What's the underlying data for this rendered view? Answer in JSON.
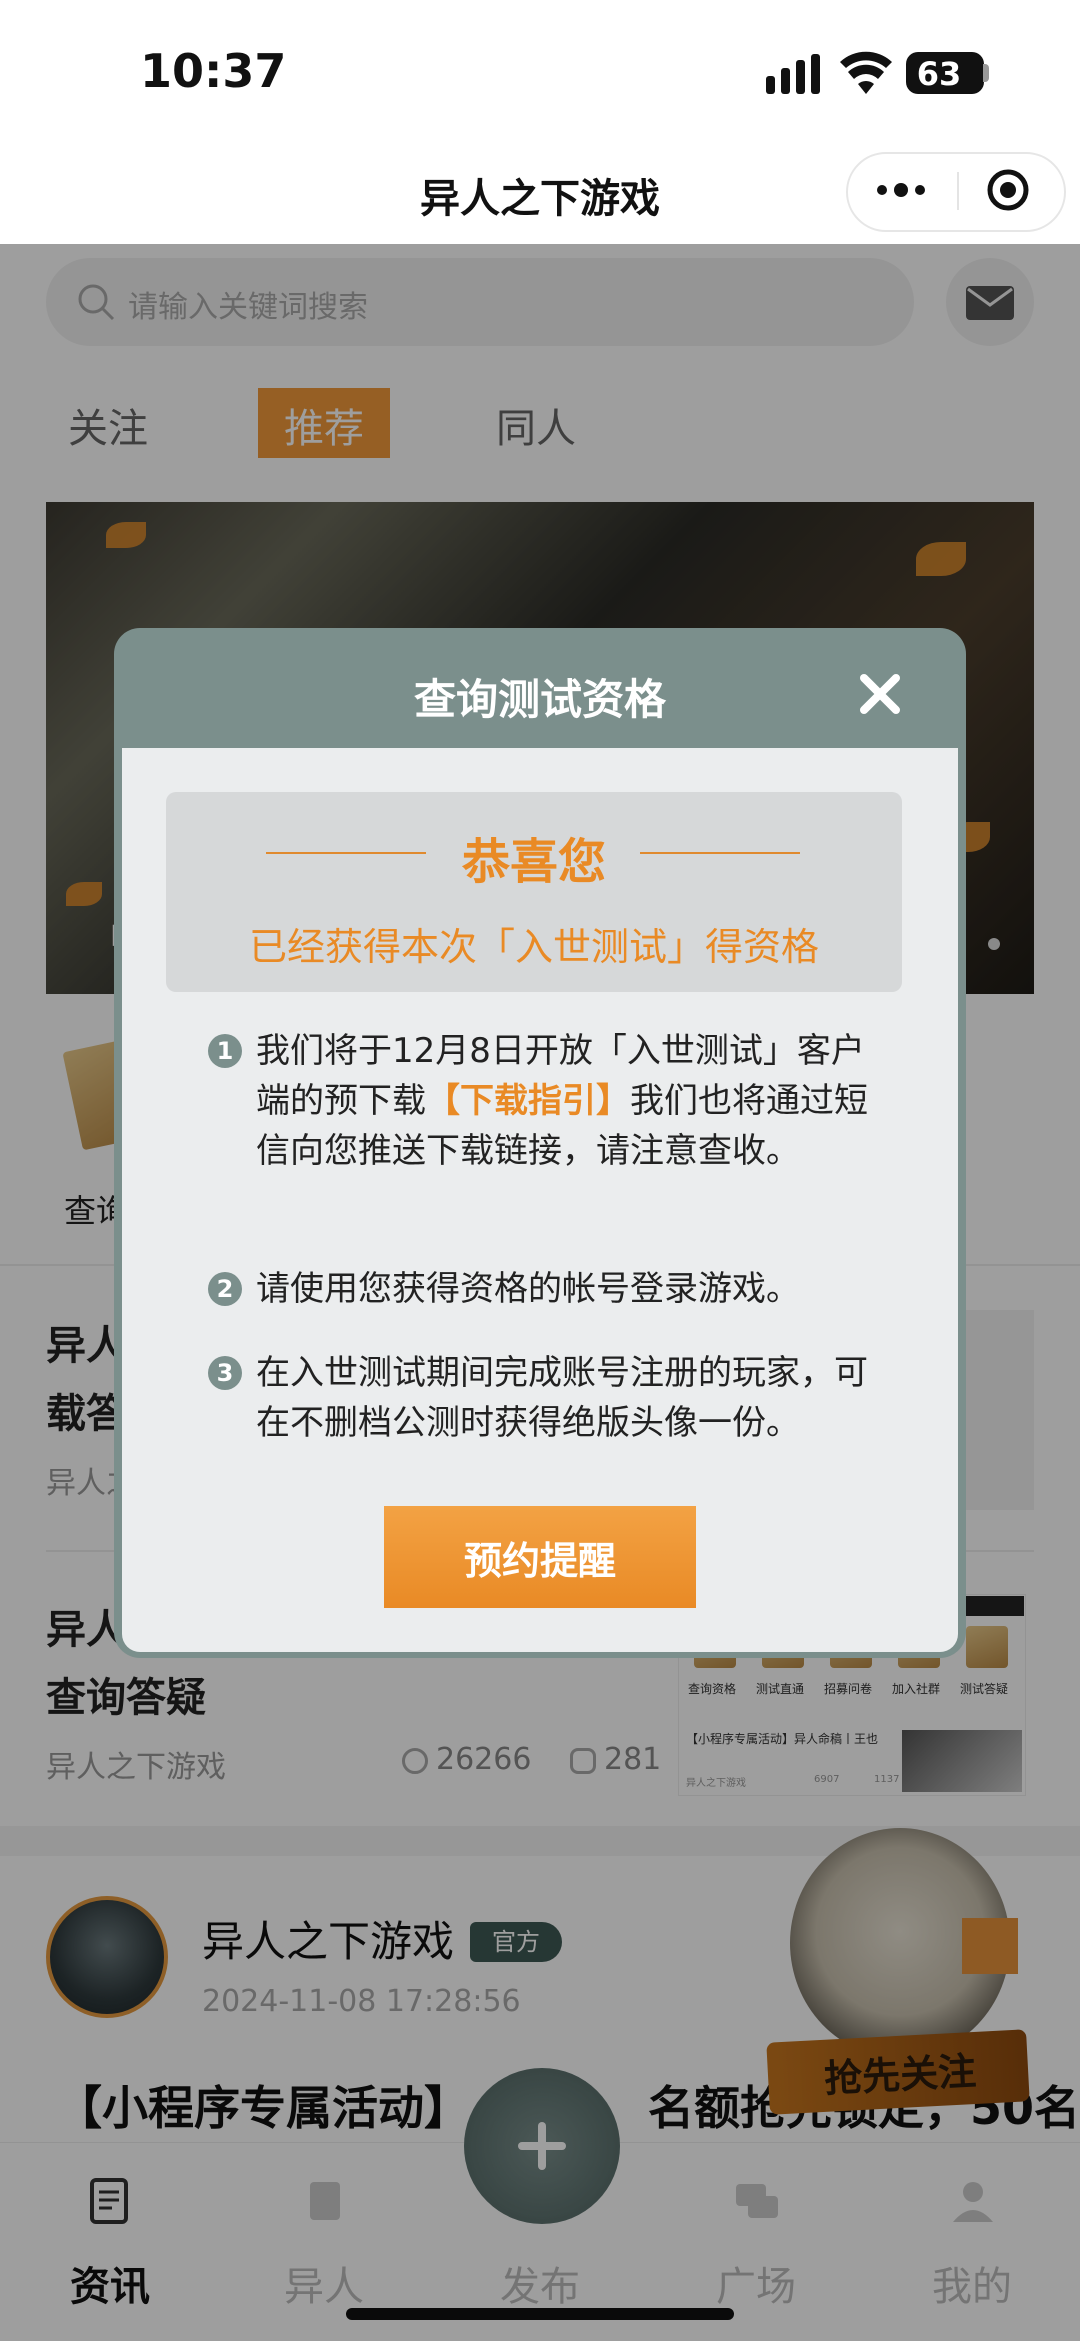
{
  "status_bar": {
    "time": "10:37",
    "battery": "63"
  },
  "nav": {
    "title": "异人之下游戏"
  },
  "search": {
    "placeholder": "请输入关键词搜索"
  },
  "tabs": [
    {
      "label": "关注"
    },
    {
      "label": "推荐"
    },
    {
      "label": "同人"
    }
  ],
  "banner": {
    "caption_fragment": "「"
  },
  "shortcut": {
    "label_fragment": "查询"
  },
  "articles": [
    {
      "title_line1": "异人",
      "title_line2": "载答",
      "source_fragment": "异人之"
    },
    {
      "title_line1": "异人",
      "title_line2": "查询答疑",
      "source": "异人之下游戏",
      "views": "26266",
      "comments": "281"
    }
  ],
  "thumb2": {
    "labels": [
      "查询资格",
      "测试直通",
      "招募问卷",
      "加入社群",
      "测试答疑"
    ],
    "post_title": "【小程序专属活动】异人命稿丨王也",
    "post_source": "异人之下游戏",
    "post_views": "6907",
    "post_comments": "1137"
  },
  "post": {
    "author": "异人之下游戏",
    "badge": "官方",
    "time": "2024-11-08 17:28:56",
    "title_left": "【小程序专属活动】",
    "title_right": "名额抢先锁定，50名"
  },
  "follow_promo": {
    "label": "抢先关注"
  },
  "bottom_tabs": [
    {
      "label": "资讯"
    },
    {
      "label": "异人"
    },
    {
      "label": "发布"
    },
    {
      "label": "广场"
    },
    {
      "label": "我的"
    }
  ],
  "modal": {
    "title": "查询测试资格",
    "congrats_title": "恭喜您",
    "congrats_sub": "已经获得本次「入世测试」得资格",
    "items": [
      {
        "num": "1",
        "text_before": "我们将于12月8日开放「入世测试」客户端的预下载",
        "link": "【下载指引】",
        "text_after": "我们也将通过短信向您推送下载链接，请注意查收。"
      },
      {
        "num": "2",
        "text": "请使用您获得资格的帐号登录游戏。"
      },
      {
        "num": "3",
        "text": "在入世测试期间完成账号注册的玩家，可在不删档公测时获得绝版头像一份。"
      }
    ],
    "button_label": "预约提醒"
  },
  "colors": {
    "accent": "#e98a25",
    "modal_header": "#7b8f8c",
    "tab_active": "#f29a3a"
  }
}
